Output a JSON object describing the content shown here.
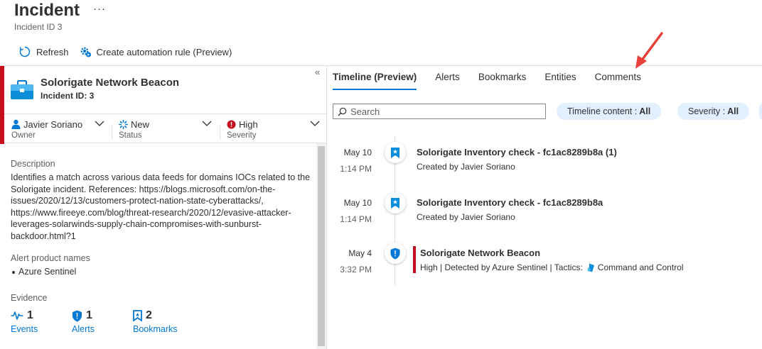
{
  "header": {
    "title": "Incident",
    "more": "···",
    "subtitle": "Incident ID 3"
  },
  "toolbar": {
    "refresh_label": "Refresh",
    "automation_label": "Create automation rule (Preview)"
  },
  "incident": {
    "name": "Solorigate Network Beacon",
    "id_label": "Incident ID: 3",
    "collapse": "«",
    "owner": {
      "value": "Javier Soriano",
      "label": "Owner"
    },
    "status": {
      "value": "New",
      "label": "Status"
    },
    "severity": {
      "value": "High",
      "label": "Severity"
    },
    "description_label": "Description",
    "description": "Identifies a match across various data feeds for domains IOCs related to the Solorigate incident. References: https://blogs.microsoft.com/on-the-issues/2020/12/13/customers-protect-nation-state-cyberattacks/, https://www.fireeye.com/blog/threat-research/2020/12/evasive-attacker-leverages-solarwinds-supply-chain-compromises-with-sunburst-backdoor.html?1",
    "alert_products_label": "Alert product names",
    "alert_products": [
      "Azure Sentinel"
    ],
    "evidence_label": "Evidence",
    "evidence": [
      {
        "count": "1",
        "label": "Events"
      },
      {
        "count": "1",
        "label": "Alerts"
      },
      {
        "count": "2",
        "label": "Bookmarks"
      }
    ]
  },
  "tabs": [
    {
      "label": "Timeline (Preview)",
      "active": true
    },
    {
      "label": "Alerts",
      "active": false
    },
    {
      "label": "Bookmarks",
      "active": false
    },
    {
      "label": "Entities",
      "active": false
    },
    {
      "label": "Comments",
      "active": false
    }
  ],
  "search": {
    "placeholder": "Search"
  },
  "filters": [
    {
      "label": "Timeline content :",
      "value": "All"
    },
    {
      "label": "Severity :",
      "value": "All"
    }
  ],
  "timeline": [
    {
      "date": "May 10",
      "time": "1:14 PM",
      "title": "Solorigate Inventory check - fc1ac8289b8a (1)",
      "subtitle": "Created by Javier Soriano",
      "kind": "bookmark"
    },
    {
      "date": "May 10",
      "time": "1:14 PM",
      "title": "Solorigate Inventory check - fc1ac8289b8a",
      "subtitle": "Created by Javier Soriano",
      "kind": "bookmark"
    },
    {
      "date": "May 4",
      "time": "3:32 PM",
      "title": "Solorigate Network Beacon",
      "subtitle": "High | Detected by Azure Sentinel | Tactics:",
      "tactic": "Command and Control",
      "kind": "alert"
    }
  ],
  "colors": {
    "accent": "#0078d4",
    "severity_high": "#c50f1f",
    "pill_bg": "#e1efff",
    "arrow": "#e8413c"
  }
}
